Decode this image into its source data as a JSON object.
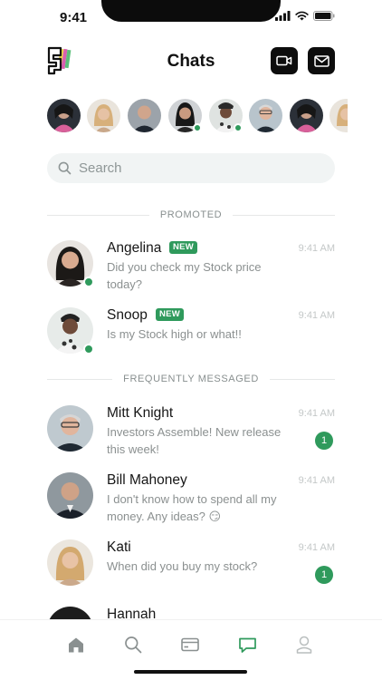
{
  "status_bar": {
    "time": "9:41"
  },
  "header": {
    "title": "Chats"
  },
  "search": {
    "placeholder": "Search"
  },
  "sections": {
    "promoted": "PROMOTED",
    "frequent": "FREQUENTLY MESSAGED"
  },
  "promoted_chats": [
    {
      "name": "Angelina",
      "badge": "NEW",
      "message": "Did you check my Stock price today?",
      "time": "9:41 AM"
    },
    {
      "name": "Snoop",
      "badge": "NEW",
      "message": "Is my Stock high or what!!",
      "time": "9:41 AM"
    }
  ],
  "frequent_chats": [
    {
      "name": "Mitt Knight",
      "message": "Investors Assemble! New release this week!",
      "time": "9:41 AM",
      "unread": "1"
    },
    {
      "name": "Bill Mahoney",
      "message": "I don't know how to spend all my money. Any ideas? 😏",
      "time": "9:41 AM"
    },
    {
      "name": "Kati",
      "message": "When did you buy my stock?",
      "time": "9:41 AM",
      "unread": "1"
    },
    {
      "name": "Hannah"
    }
  ],
  "colors": {
    "accent": "#2f9a5c",
    "dark": "#0d0d0d",
    "muted": "#8b9090"
  },
  "nav": [
    "home-icon",
    "search-icon",
    "wallet-icon",
    "chat-icon",
    "profile-icon"
  ]
}
